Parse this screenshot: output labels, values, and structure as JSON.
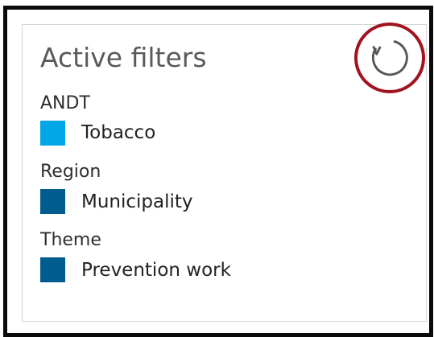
{
  "panel": {
    "title": "Active filters",
    "reset_icon": "reset-refresh-icon",
    "highlight_color": "#a0131f"
  },
  "filters": [
    {
      "group": "ANDT",
      "value": "Tobacco",
      "color": "#00a6e6"
    },
    {
      "group": "Region",
      "value": "Municipality",
      "color": "#005c8f"
    },
    {
      "group": "Theme",
      "value": "Prevention work",
      "color": "#005c8f"
    }
  ]
}
